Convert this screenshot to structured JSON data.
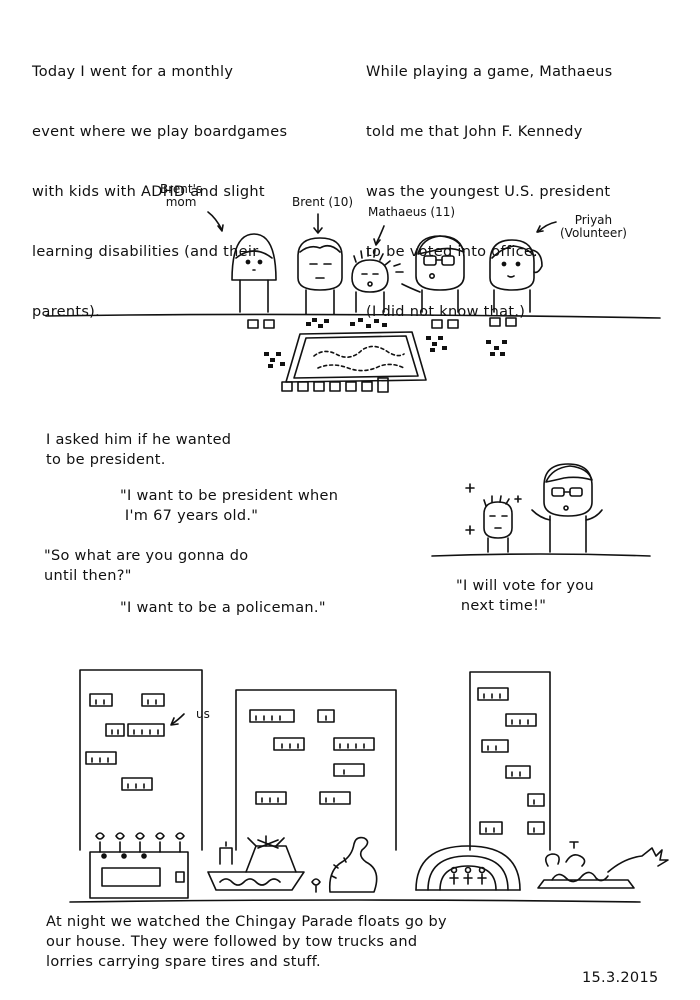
{
  "panel1": {
    "intro_lines": [
      "Today I went for a monthly",
      "event where we play boardgames",
      "with kids with ADHD and slight",
      "learning disabilities (and their",
      "parents)."
    ],
    "fact_lines": [
      "While playing a game, Mathaeus",
      "told me that John F. Kennedy",
      "was the youngest U.S. president",
      "to be voted into office.",
      "(I did not know that.)"
    ],
    "labels": {
      "brents_mom": "Brent's\nmom",
      "brent": "Brent (10)",
      "mathaeus": "Mathaeus (11)",
      "priyah": "Priyah\n(Volunteer)"
    }
  },
  "panel2": {
    "asked": "I asked him if he wanted\nto be president.",
    "quote1": "\"I want to be president when\n I'm 67 years old.\"",
    "quote2": "\"So what are you gonna do\nuntil then?\"",
    "quote3": "\"I want to be a policeman.\"",
    "vote": "\"I will vote for you\n next time!\""
  },
  "panel3": {
    "us_label": "us",
    "caption": "At night we watched the Chingay Parade floats go by\nour house. They were followed by tow trucks and\nlorries carrying spare tires and stuff.",
    "date": "15.3.2015"
  }
}
